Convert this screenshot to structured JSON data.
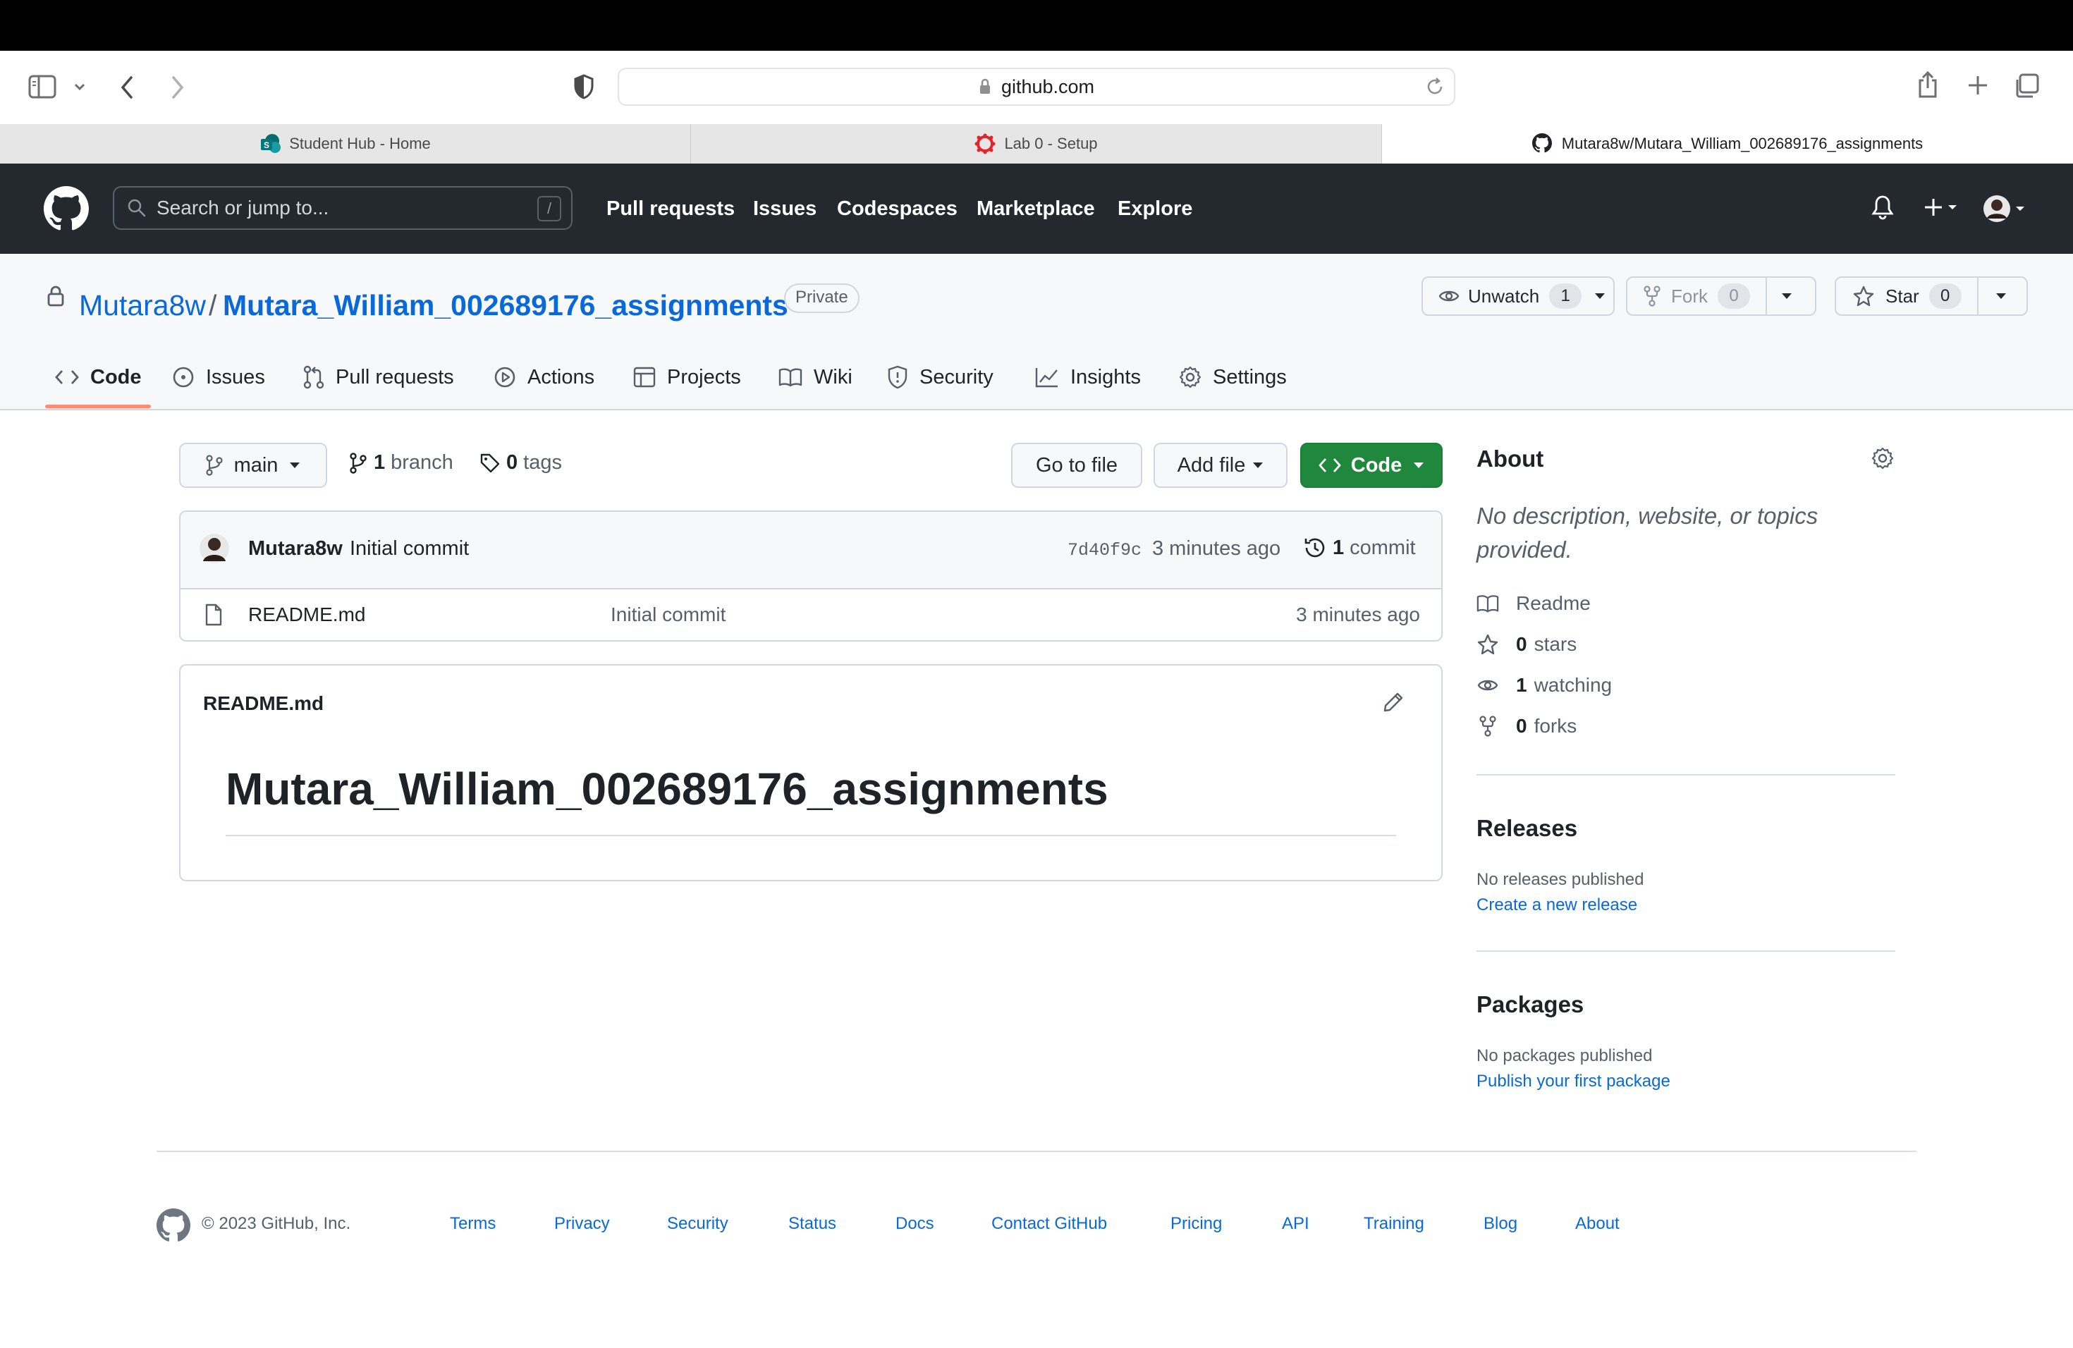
{
  "browser": {
    "url": "github.com",
    "tabs": [
      {
        "label": "Student Hub - Home"
      },
      {
        "label": "Lab 0 - Setup"
      },
      {
        "label": "Mutara8w/Mutara_William_002689176_assignments"
      }
    ]
  },
  "github_header": {
    "search_placeholder": "Search or jump to...",
    "search_shortcut": "/",
    "nav": [
      "Pull requests",
      "Issues",
      "Codespaces",
      "Marketplace",
      "Explore"
    ]
  },
  "repo": {
    "owner": "Mutara8w",
    "separator": "/",
    "name": "Mutara_William_002689176_assignments",
    "visibility": "Private",
    "unwatch_label": "Unwatch",
    "watch_count": "1",
    "fork_label": "Fork",
    "fork_count": "0",
    "star_label": "Star",
    "star_count": "0",
    "tabs": [
      "Code",
      "Issues",
      "Pull requests",
      "Actions",
      "Projects",
      "Wiki",
      "Security",
      "Insights",
      "Settings"
    ]
  },
  "toolbar": {
    "branch": "main",
    "branch_count": "1",
    "branch_label": "branch",
    "tag_count": "0",
    "tag_label": "tags",
    "go_to_file": "Go to file",
    "add_file": "Add file",
    "code": "Code"
  },
  "commit": {
    "author": "Mutara8w",
    "message": "Initial commit",
    "sha": "7d40f9c",
    "time": "3 minutes ago",
    "commit_count": "1",
    "commit_label": "commit"
  },
  "files": [
    {
      "name": "README.md",
      "message": "Initial commit",
      "time": "3 minutes ago"
    }
  ],
  "readme": {
    "filename": "README.md",
    "heading": "Mutara_William_002689176_assignments"
  },
  "about": {
    "title": "About",
    "description": "No description, website, or topics provided.",
    "readme": "Readme",
    "stars_count": "0",
    "stars_label": "stars",
    "watching_count": "1",
    "watching_label": "watching",
    "forks_count": "0",
    "forks_label": "forks"
  },
  "releases": {
    "title": "Releases",
    "none": "No releases published",
    "link": "Create a new release"
  },
  "packages": {
    "title": "Packages",
    "none": "No packages published",
    "link": "Publish your first package"
  },
  "footer": {
    "copyright": "© 2023 GitHub, Inc.",
    "links": [
      "Terms",
      "Privacy",
      "Security",
      "Status",
      "Docs",
      "Contact GitHub",
      "Pricing",
      "API",
      "Training",
      "Blog",
      "About"
    ]
  },
  "colors": {
    "header_bg": "#24292f",
    "link": "#0969da",
    "primary_button": "#1f883d",
    "tab_underline": "#fd8c73"
  }
}
